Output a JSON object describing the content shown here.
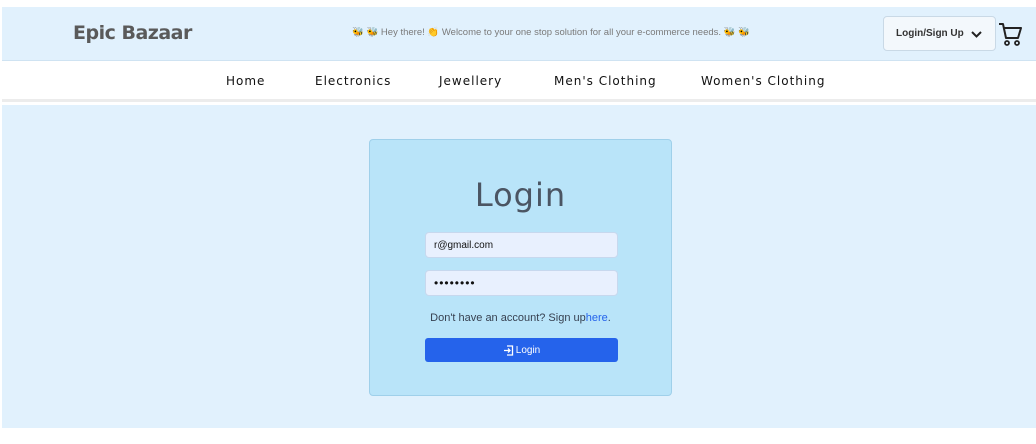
{
  "header": {
    "brand": "Epic Bazaar",
    "welcome_text": "🐝 🐝 Hey there! 👏 Welcome to your one stop solution for all your e-commerce needs. 🐝 🐝",
    "login_menu_label": "Login/Sign Up"
  },
  "nav": {
    "items": [
      {
        "label": "Home"
      },
      {
        "label": "Electronics"
      },
      {
        "label": "Jewellery"
      },
      {
        "label": "Men's Clothing"
      },
      {
        "label": "Women's Clothing"
      }
    ]
  },
  "login_form": {
    "title": "Login",
    "email_value": "r@gmail.com",
    "password_value": "••••••••",
    "signup_prompt": "Don't have an account? Sign up",
    "signup_link": "here",
    "signup_suffix": ".",
    "submit_label": "Login"
  },
  "colors": {
    "background": "#e1f1fd",
    "card": "#b9e4f9",
    "primary": "#2563eb"
  },
  "icons": [
    "chevron-down-icon",
    "cart-icon",
    "login-icon"
  ]
}
